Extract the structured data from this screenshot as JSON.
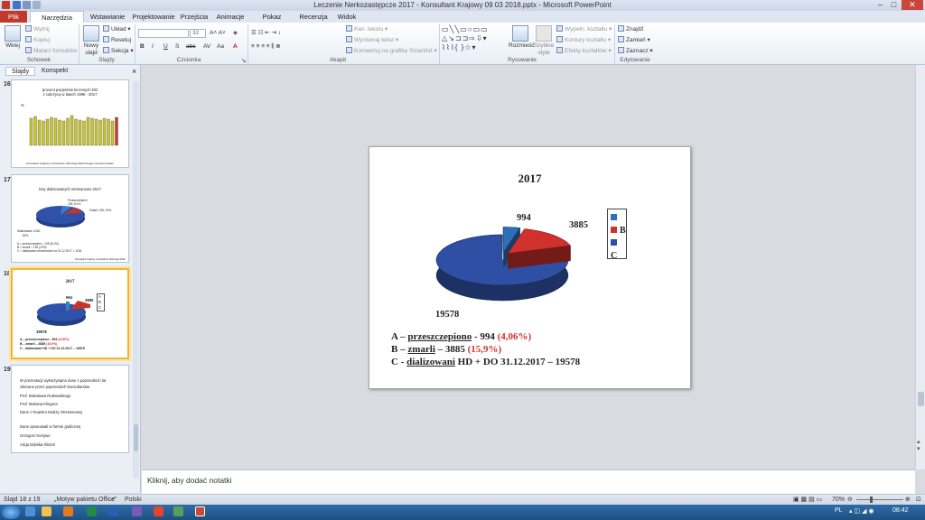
{
  "window": {
    "title": "Leczenie Nerkozastępcze 2017 - Konsultant Krajowy 09 03 2018.pptx - Microsoft PowerPoint",
    "controls": [
      "–",
      "□",
      "✕"
    ]
  },
  "tabs": [
    "Plik",
    "Narzędzia główne",
    "Wstawianie",
    "Projektowanie",
    "Przejścia",
    "Animacje",
    "Pokaz slajdów",
    "Recenzja",
    "Widok"
  ],
  "ribbon": {
    "clipboard": {
      "paste": "Wklej",
      "cut": "Wytnij",
      "copy": "Kopiuj",
      "painter": "Malarz formatów",
      "label": "Schowek"
    },
    "slides": {
      "new": "Nowy slajd",
      "layout": "Układ",
      "reset": "Resetuj",
      "section": "Sekcja",
      "label": "Slajdy"
    },
    "font": {
      "size": "32",
      "bold": "B",
      "italic": "I",
      "underline": "U",
      "strike": "S",
      "shadow": "abc",
      "label": "Czcionka"
    },
    "paragraph": {
      "direction": "Kier. tekstu",
      "align": "Wyrównaj tekst",
      "smartart": "Konwertuj na grafikę SmartArt",
      "label": "Akapit"
    },
    "drawing": {
      "arrange": "Rozmieść",
      "quick": "Szybkie style",
      "fill": "Wypełn. kształtu",
      "outline": "Kontury kształtu",
      "effects": "Efekty kształtów",
      "label": "Rysowanie"
    },
    "editing": {
      "find": "Znajdź",
      "replace": "Zamień",
      "select": "Zaznacz",
      "label": "Edytowanie"
    }
  },
  "pane": {
    "tabs": [
      "Slajdy",
      "Konspekt"
    ],
    "close": "×",
    "thumbs": {
      "t16": {
        "num": "16",
        "title1": "procent pacjentów leczonych DO",
        "title2": "z cukrzycą w latach 1996 - 2017",
        "axis": "%",
        "footer": "Konsultant Krajowy w dziedzinie Nefrologii Maria Klinger, Ryszard Gellert"
      },
      "t17": {
        "num": "17",
        "title": "losy dializowanych otrzewnowo 2017",
        "p1": "Przeszczepieni",
        "p1v": "109; 8,1%",
        "p2": "Zmarli; 135; 10%",
        "p3": "Dializowani; 1136;",
        "p3v": "82%",
        "l1": "A = przeszczepieni = 109 (8,1%)",
        "l2": "B = zmarli = 135 (10%)",
        "l3": "C = dializowani otrzewnowo na 31.12.2017 = 1136",
        "footer": "Konsultant Krajowy w dziedzinie Nefrologii 2018"
      },
      "t18": {
        "num": "18",
        "title": "2017",
        "v1": "994",
        "v2": "3885",
        "v3": "19578",
        "la": "A",
        "lb": "B",
        "lc": "C",
        "l1a": "A – przeszczepiono - 994 ",
        "l1b": "(4,06%)",
        "l2a": "B – zmarli – 3885 ",
        "l2b": "(15,9%)",
        "l3": "C - dializowani HD + DO 31.12.2017 – 19578"
      },
      "t19": {
        "num": "19",
        "lines": [
          "W prezentacji wykorzystano dane z poprzednich lat",
          "zbierane przez poprzednich konsultantów",
          "Prof. Bolesława Rutkowskiego",
          "Prof. Mariana Klingera",
          "Dane z Rejestru Dializy Otrzewnowej",
          "Dane opracowali w formie graficznej",
          "Grzegorz Korejwo",
          "Alicja Dębska-Ślizień"
        ]
      }
    }
  },
  "slide": {
    "title": "2017",
    "legend": [
      {
        "label": "A",
        "color": "#2e6fb5"
      },
      {
        "label": "B",
        "color": "#d0312d"
      },
      {
        "label": "C",
        "color": "#2e4fa3"
      }
    ],
    "labels": {
      "a": "994",
      "b": "3885",
      "c": "19578"
    },
    "lines": {
      "a_pre": "A – ",
      "a_u": "przeszczepiono",
      "a_mid": "  - 994  ",
      "a_pct": "(4,06%)",
      "b_pre": "B – ",
      "b_u": "zmarli",
      "b_mid": "  – 3885  ",
      "b_pct": "(15,9%)",
      "c_pre": "C - ",
      "c_u": "dializowani",
      "c_mid": " HD + DO  31.12.2017 – 19578"
    }
  },
  "chart_data": {
    "type": "pie",
    "title": "2017",
    "categories": [
      "A",
      "B",
      "C"
    ],
    "values": [
      994,
      3885,
      19578
    ],
    "colors": [
      "#2e6fb5",
      "#d0312d",
      "#2e4fa3"
    ],
    "legend": "right"
  },
  "notes": {
    "placeholder": "Kliknij, aby dodać notatki"
  },
  "status": {
    "slide": "Slajd 18 z 19",
    "theme": "„Motyw pakietu Office”",
    "lang": "Polski",
    "zoom": "70%",
    "lang_ind": "PL",
    "time": "08:42"
  }
}
